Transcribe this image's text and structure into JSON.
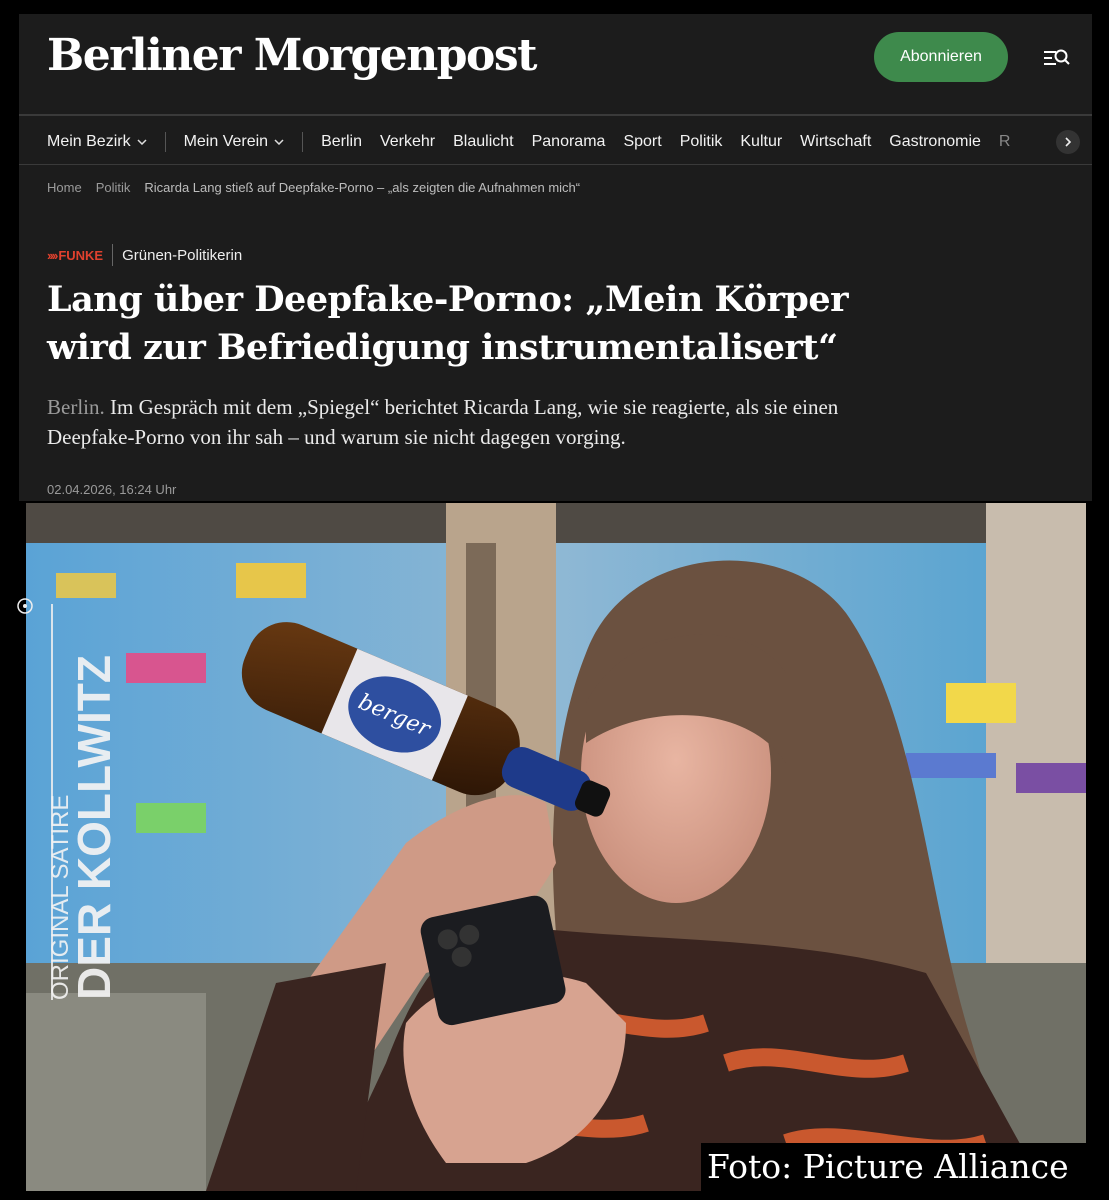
{
  "header": {
    "logo": "Berliner Morgenpost",
    "subscribe_label": "Abonnieren",
    "menu_icon": "menu-search-icon"
  },
  "nav": {
    "dropdowns": [
      "Mein Bezirk",
      "Mein Verein"
    ],
    "items": [
      "Berlin",
      "Verkehr",
      "Blaulicht",
      "Panorama",
      "Sport",
      "Politik",
      "Kultur",
      "Wirtschaft",
      "Gastronomie"
    ],
    "overflow_fragment": "R",
    "next_icon": "chevron-right-icon"
  },
  "breadcrumb": [
    "Home",
    "Politik",
    "Ricarda Lang stieß auf Deepfake-Porno – „als zeigten die Aufnahmen mich“"
  ],
  "article": {
    "brand": "FUNKE",
    "brand_marks": "››››",
    "kicker": "Grünen-Politikerin",
    "headline": "Lang über Deepfake-Porno: „Mein Körper wird zur Befriedigung instrumentalisert“",
    "location": "Berlin.",
    "teaser": "Im Gespräch mit dem „Spiegel“ berichtet Ricarda Lang, wie sie reagierte, als sie einen Deepfake-Porno von ihr sah – und warum sie nicht dagegen vorging.",
    "date": "02.04.2026, 16:24 Uhr"
  },
  "photo": {
    "watermark_small": "ORIGINAL SATIRE",
    "watermark_large": "DER KOLLWITZ",
    "credit": "Foto: Picture Alliance",
    "bottle_label": "berger"
  },
  "colors": {
    "page_bg": "#1c1c1c",
    "subscribe_green": "#3e8a4c",
    "funke_red": "#e0412e"
  }
}
